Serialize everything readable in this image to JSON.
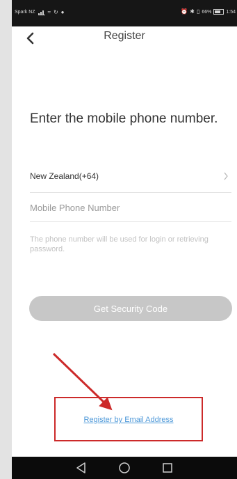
{
  "status_bar": {
    "carrier": "Spark NZ",
    "battery_text": "66%",
    "time": "1:54",
    "battery_level": 0.66
  },
  "header": {
    "title": "Register",
    "back_icon": "chevron-left-icon"
  },
  "main": {
    "headline": "Enter the mobile phone number.",
    "country": {
      "label": "New Zealand(+64)",
      "icon": "chevron-right-icon"
    },
    "phone_input": {
      "placeholder": "Mobile Phone Number",
      "value": ""
    },
    "hint": "The phone number will be used for login or retrieving password.",
    "get_code_label": "Get Security Code",
    "email_link_label": "Register by Email Address"
  },
  "nav_bar": {
    "icons": [
      "back-triangle-icon",
      "home-circle-icon",
      "recents-square-icon"
    ]
  },
  "colors": {
    "link": "#4b97d8",
    "button_disabled": "#c7c7c7",
    "annotation_red": "#cc2a2a",
    "status_bar_bg": "#161616",
    "nav_bar_bg": "#0b0b0b"
  }
}
